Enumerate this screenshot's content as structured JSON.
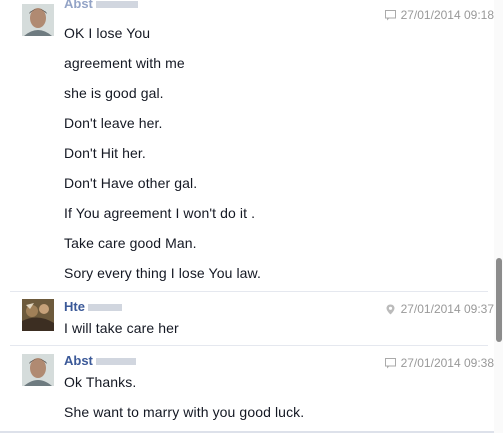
{
  "messages": [
    {
      "sender": "Abst",
      "time": "27/01/2014 09:18",
      "time_icon": "chat-icon",
      "lines": [
        "OK I lose You",
        "agreement with me",
        "she is good gal.",
        "Don't leave her.",
        "Don't Hit her.",
        "Don't Have other gal.",
        "If You agreement  I won't do it .",
        "Take care good Man.",
        "Sory every thing I lose You law."
      ]
    },
    {
      "sender": "Hte",
      "time": "27/01/2014 09:37",
      "time_icon": "location-pin-icon",
      "lines": [
        "I will take care her"
      ]
    },
    {
      "sender": "Abst",
      "time": "27/01/2014 09:38",
      "time_icon": "chat-icon",
      "lines": [
        "Ok Thanks.",
        "She want to marry with you good luck."
      ]
    }
  ],
  "colors": {
    "sender": "#3b5998",
    "text": "#141823",
    "time": "#999999",
    "divider": "#e5e8ef"
  }
}
